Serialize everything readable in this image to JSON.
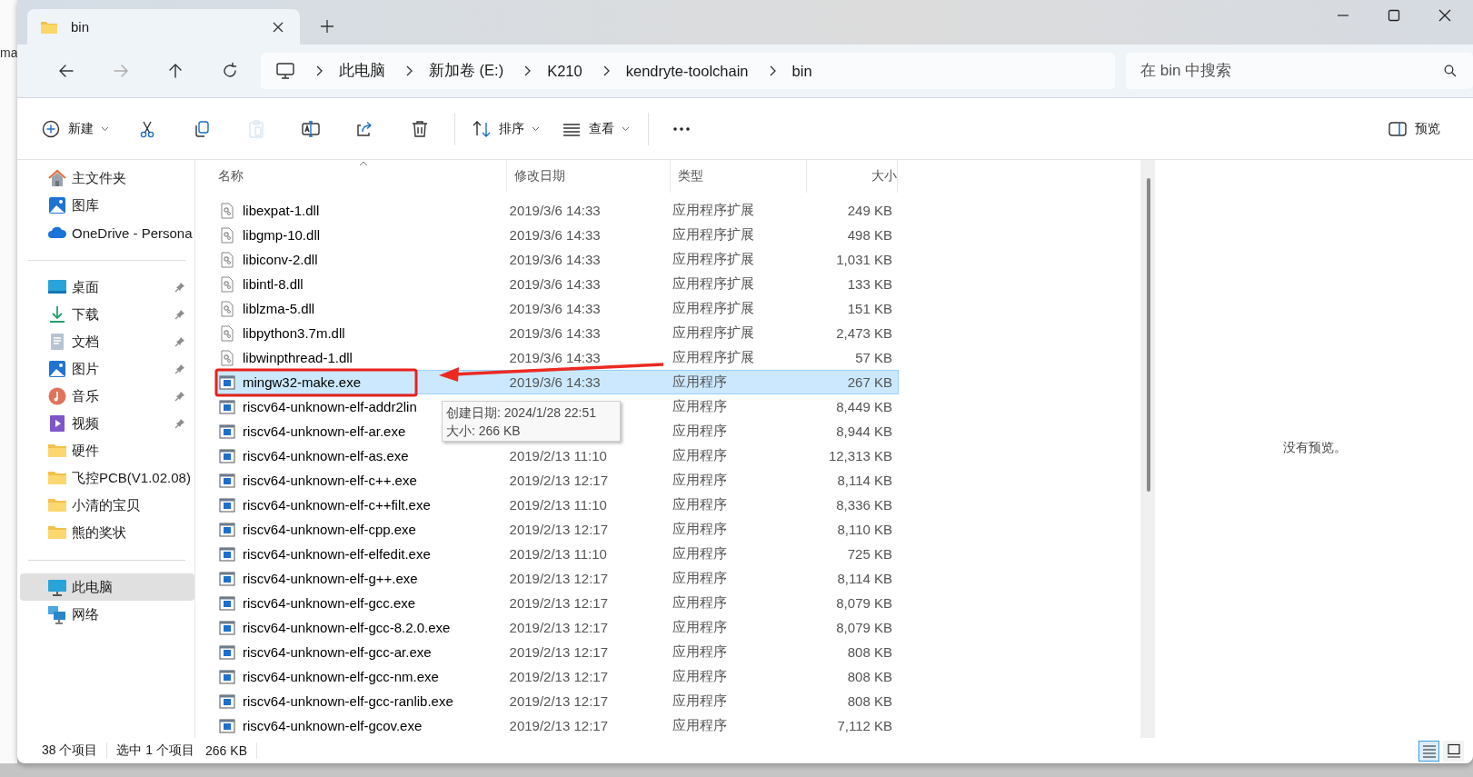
{
  "background_window": {
    "text": "ma"
  },
  "tabs": [
    {
      "title": "bin",
      "selected": true
    }
  ],
  "nav_buttons": [
    {
      "kind": "back",
      "disabled": false
    },
    {
      "kind": "forward",
      "disabled": true
    },
    {
      "kind": "up",
      "disabled": false
    },
    {
      "kind": "refresh",
      "disabled": false
    }
  ],
  "address": {
    "crumbs": [
      "此电脑",
      "新加卷 (E:)",
      "K210",
      "kendryte-toolchain",
      "bin"
    ]
  },
  "search": {
    "placeholder": "在 bin 中搜索"
  },
  "toolbar": {
    "items": [
      {
        "kind": "new",
        "label": "新建",
        "disabled": false
      },
      {
        "kind": "cut",
        "disabled": false
      },
      {
        "kind": "copy",
        "disabled": false
      },
      {
        "kind": "paste",
        "disabled": true
      },
      {
        "kind": "rename",
        "disabled": false
      },
      {
        "kind": "share",
        "disabled": false
      },
      {
        "kind": "delete",
        "disabled": false
      },
      {
        "kind": "separator"
      },
      {
        "kind": "sort",
        "label": "排序",
        "disabled": false
      },
      {
        "kind": "view",
        "label": "查看",
        "disabled": false
      },
      {
        "kind": "separator"
      },
      {
        "kind": "more",
        "disabled": false
      }
    ],
    "preview_label": "预览"
  },
  "sidebar": {
    "groups": [
      {
        "items": [
          {
            "kind": "home",
            "label": "主文件夹",
            "pinned": false,
            "selected": false
          },
          {
            "kind": "gallery",
            "label": "图库",
            "pinned": false,
            "selected": false
          },
          {
            "kind": "cloud",
            "label": "OneDrive - Persona",
            "pinned": false,
            "selected": false
          }
        ]
      },
      {
        "items": [
          {
            "kind": "desktop",
            "label": "桌面",
            "pinned": true,
            "selected": false
          },
          {
            "kind": "download",
            "label": "下载",
            "pinned": true,
            "selected": false
          },
          {
            "kind": "documents",
            "label": "文档",
            "pinned": true,
            "selected": false
          },
          {
            "kind": "pictures",
            "label": "图片",
            "pinned": true,
            "selected": false
          },
          {
            "kind": "music",
            "label": "音乐",
            "pinned": true,
            "selected": false
          },
          {
            "kind": "videos",
            "label": "视频",
            "pinned": true,
            "selected": false
          },
          {
            "kind": "folder",
            "label": "硬件",
            "pinned": false,
            "selected": false
          },
          {
            "kind": "folder",
            "label": "飞控PCB(V1.02.08)",
            "pinned": false,
            "selected": false
          },
          {
            "kind": "folder",
            "label": "小清的宝贝",
            "pinned": false,
            "selected": false
          },
          {
            "kind": "folder",
            "label": "熊的奖状",
            "pinned": false,
            "selected": false
          }
        ]
      },
      {
        "items": [
          {
            "kind": "pc",
            "label": "此电脑",
            "pinned": false,
            "selected": true
          },
          {
            "kind": "network",
            "label": "网络",
            "pinned": false,
            "selected": false
          }
        ]
      }
    ]
  },
  "columns": [
    {
      "label": "名称",
      "sorted": true
    },
    {
      "label": "修改日期",
      "sorted": false
    },
    {
      "label": "类型",
      "sorted": false
    },
    {
      "label": "大小",
      "sorted": false
    }
  ],
  "rows": [
    {
      "kind": "dll",
      "name": "libexpat-1.dll",
      "date": "2019/3/6 14:33",
      "type": "应用程序扩展",
      "size": "249 KB",
      "selected": false
    },
    {
      "kind": "dll",
      "name": "libgmp-10.dll",
      "date": "2019/3/6 14:33",
      "type": "应用程序扩展",
      "size": "498 KB",
      "selected": false
    },
    {
      "kind": "dll",
      "name": "libiconv-2.dll",
      "date": "2019/3/6 14:33",
      "type": "应用程序扩展",
      "size": "1,031 KB",
      "selected": false
    },
    {
      "kind": "dll",
      "name": "libintl-8.dll",
      "date": "2019/3/6 14:33",
      "type": "应用程序扩展",
      "size": "133 KB",
      "selected": false
    },
    {
      "kind": "dll",
      "name": "liblzma-5.dll",
      "date": "2019/3/6 14:33",
      "type": "应用程序扩展",
      "size": "151 KB",
      "selected": false
    },
    {
      "kind": "dll",
      "name": "libpython3.7m.dll",
      "date": "2019/3/6 14:33",
      "type": "应用程序扩展",
      "size": "2,473 KB",
      "selected": false
    },
    {
      "kind": "dll",
      "name": "libwinpthread-1.dll",
      "date": "2019/3/6 14:33",
      "type": "应用程序扩展",
      "size": "57 KB",
      "selected": false
    },
    {
      "kind": "exe",
      "name": "mingw32-make.exe",
      "date": "2019/3/6 14:33",
      "type": "应用程序",
      "size": "267 KB",
      "selected": true
    },
    {
      "kind": "exe",
      "name": "riscv64-unknown-elf-addr2lin",
      "type": "应用程序",
      "size": "8,449 KB",
      "selected": false
    },
    {
      "kind": "exe",
      "name": "riscv64-unknown-elf-ar.exe",
      "type": "应用程序",
      "size": "8,944 KB",
      "selected": false
    },
    {
      "kind": "exe",
      "name": "riscv64-unknown-elf-as.exe",
      "date": "2019/2/13 11:10",
      "type": "应用程序",
      "size": "12,313 KB",
      "selected": false
    },
    {
      "kind": "exe",
      "name": "riscv64-unknown-elf-c++.exe",
      "date": "2019/2/13 12:17",
      "type": "应用程序",
      "size": "8,114 KB",
      "selected": false
    },
    {
      "kind": "exe",
      "name": "riscv64-unknown-elf-c++filt.exe",
      "date": "2019/2/13 11:10",
      "type": "应用程序",
      "size": "8,336 KB",
      "selected": false
    },
    {
      "kind": "exe",
      "name": "riscv64-unknown-elf-cpp.exe",
      "date": "2019/2/13 12:17",
      "type": "应用程序",
      "size": "8,110 KB",
      "selected": false
    },
    {
      "kind": "exe",
      "name": "riscv64-unknown-elf-elfedit.exe",
      "date": "2019/2/13 11:10",
      "type": "应用程序",
      "size": "725 KB",
      "selected": false
    },
    {
      "kind": "exe",
      "name": "riscv64-unknown-elf-g++.exe",
      "date": "2019/2/13 12:17",
      "type": "应用程序",
      "size": "8,114 KB",
      "selected": false
    },
    {
      "kind": "exe",
      "name": "riscv64-unknown-elf-gcc.exe",
      "date": "2019/2/13 12:17",
      "type": "应用程序",
      "size": "8,079 KB",
      "selected": false
    },
    {
      "kind": "exe",
      "name": "riscv64-unknown-elf-gcc-8.2.0.exe",
      "date": "2019/2/13 12:17",
      "type": "应用程序",
      "size": "8,079 KB",
      "selected": false
    },
    {
      "kind": "exe",
      "name": "riscv64-unknown-elf-gcc-ar.exe",
      "date": "2019/2/13 12:17",
      "type": "应用程序",
      "size": "808 KB",
      "selected": false
    },
    {
      "kind": "exe",
      "name": "riscv64-unknown-elf-gcc-nm.exe",
      "date": "2019/2/13 12:17",
      "type": "应用程序",
      "size": "808 KB",
      "selected": false
    },
    {
      "kind": "exe",
      "name": "riscv64-unknown-elf-gcc-ranlib.exe",
      "date": "2019/2/13 12:17",
      "type": "应用程序",
      "size": "808 KB",
      "selected": false
    },
    {
      "kind": "exe",
      "name": "riscv64-unknown-elf-gcov.exe",
      "date": "2019/2/13 12:17",
      "type": "应用程序",
      "size": "7,112 KB",
      "selected": false
    }
  ],
  "tooltip": {
    "lines": [
      "创建日期: 2024/1/28 22:51",
      "大小: 266 KB"
    ]
  },
  "preview": {
    "message": "没有预览。"
  },
  "status_bar": {
    "count": "38 个项目",
    "selection": "选中 1 个项目",
    "selection_size": "266 KB"
  },
  "view_modes": [
    {
      "kind": "details",
      "selected": true
    },
    {
      "kind": "tiles",
      "selected": false
    }
  ]
}
